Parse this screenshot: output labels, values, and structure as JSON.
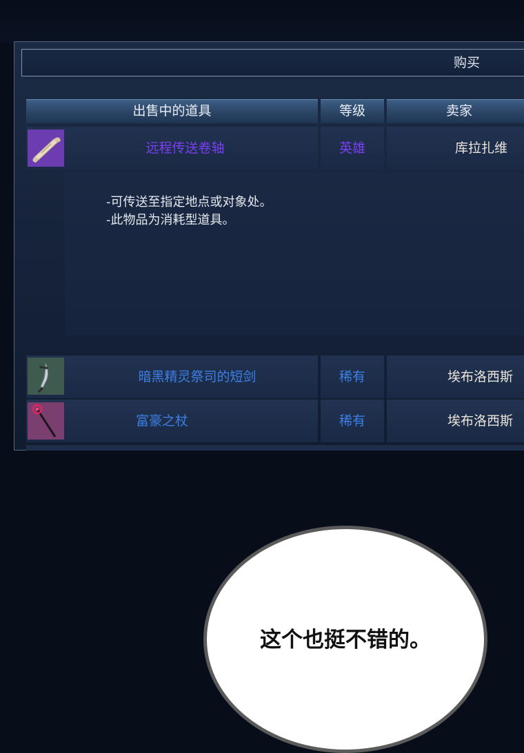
{
  "buy_button": "购买",
  "columns": {
    "item": "出售中的道具",
    "grade": "等级",
    "seller": "卖家"
  },
  "items": [
    {
      "name": "远程传送卷轴",
      "grade": "英雄",
      "seller": "库拉扎维",
      "icon": "scroll-icon",
      "name_color": "#7b3ff2",
      "grade_color": "#7b3ff2"
    },
    {
      "name": "暗黑精灵祭司的短剑",
      "grade": "稀有",
      "seller": "埃布洛西斯",
      "icon": "dagger-icon",
      "name_color": "#3d7fe6",
      "grade_color": "#3d7fe6"
    },
    {
      "name": "富豪之杖",
      "grade": "稀有",
      "seller": "埃布洛西斯",
      "icon": "staff-icon",
      "name_color": "#3d7fe6",
      "grade_color": "#3d7fe6"
    }
  ],
  "description": {
    "line1": "-可传送至指定地点或对象处。",
    "line2": "-此物品为消耗型道具。"
  },
  "speech_bubble": "这个也挺不错的。"
}
